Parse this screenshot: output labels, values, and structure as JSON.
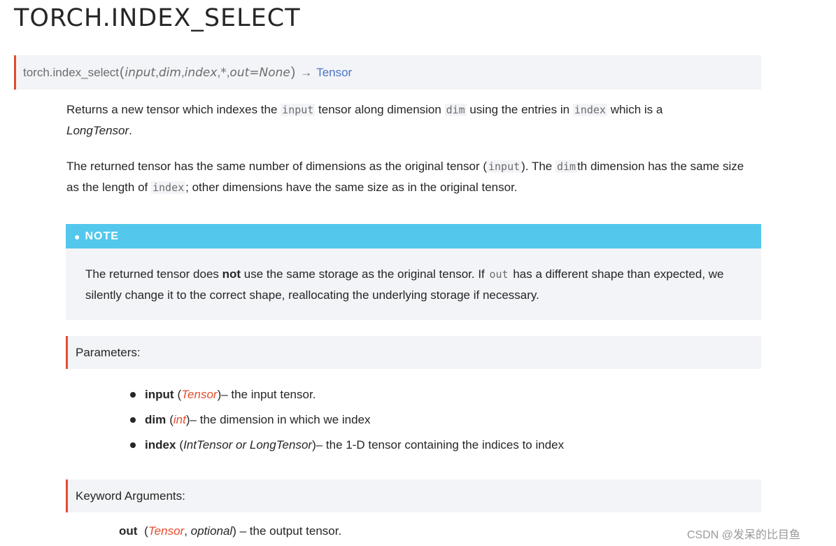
{
  "page_title": "TORCH.INDEX_SELECT",
  "signature": {
    "function": "torch.index_select",
    "open_paren": "(",
    "close_paren": ")",
    "args": [
      "input",
      "dim",
      "index",
      "*",
      "out=None"
    ],
    "separator": ", ",
    "arrow": "→",
    "return_type": "Tensor"
  },
  "description": {
    "p1": {
      "t1": "Returns a new tensor which indexes the ",
      "c1": "input",
      "t2": " tensor along dimension ",
      "c2": "dim",
      "t3": " using the entries in ",
      "c3": "index",
      "t4": " which is a ",
      "t5": "LongTensor",
      "t6": "."
    },
    "p2": {
      "t1": "The returned tensor has the same number of dimensions as the original tensor (",
      "c1": "input",
      "t2": "). The ",
      "c2": "dim",
      "t3": "th dimension has the same size as the length of ",
      "c3": "index",
      "t4": "; other dimensions have the same size as in the original tensor."
    }
  },
  "note": {
    "header": "NOTE",
    "t1": "The returned tensor does ",
    "bold": "not",
    "t2": " use the same storage as the original tensor. If ",
    "code": "out",
    "t3": " has a different shape than expected, we silently change it to the correct shape, reallocating the underlying storage if necessary."
  },
  "parameters": {
    "header": "Parameters:",
    "items": [
      {
        "name": "input",
        "open": "(",
        "type": "Tensor",
        "close": ")",
        "desc": " – the input tensor."
      },
      {
        "name": "dim",
        "open": "(",
        "type": "int",
        "close": ")",
        "desc": " – the dimension in which we index"
      },
      {
        "name": "index",
        "open": "(",
        "type": "IntTensor or LongTensor",
        "close": ")",
        "desc": " – the 1-D tensor containing the indices to index"
      }
    ]
  },
  "keyword_arguments": {
    "header": "Keyword Arguments:",
    "item": {
      "name": "out",
      "open": "(",
      "type": "Tensor",
      "comma": ", ",
      "optional": "optional",
      "close": ")",
      "desc": " – the output tensor."
    }
  },
  "watermark": "CSDN @发呆的比目鱼",
  "colors": {
    "accent_red": "#e44c2c",
    "note_blue": "#54c7ec",
    "link_blue": "#4a74c9",
    "panel_bg": "#f3f4f7"
  }
}
